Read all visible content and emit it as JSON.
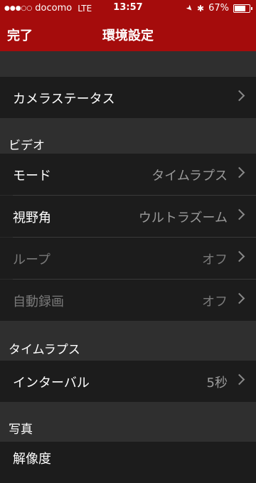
{
  "status_bar": {
    "signal_dots": "●●●○○",
    "carrier": "docomo",
    "network": "LTE",
    "time": "13:57",
    "location_icon": "location-arrow-icon",
    "bluetooth_icon": "bluetooth-icon",
    "bluetooth_glyph": "✱",
    "battery_percent": "67%",
    "battery_level": 0.67
  },
  "nav": {
    "done_label": "完了",
    "title": "環境設定"
  },
  "camera_status": {
    "label": "カメラステータス"
  },
  "video": {
    "header": "ビデオ",
    "rows": [
      {
        "label": "モード",
        "value": "タイムラプス",
        "enabled": true
      },
      {
        "label": "視野角",
        "value": "ウルトラズーム",
        "enabled": true
      },
      {
        "label": "ループ",
        "value": "オフ",
        "enabled": false
      },
      {
        "label": "自動録画",
        "value": "オフ",
        "enabled": false
      }
    ]
  },
  "timelapse": {
    "header": "タイムラプス",
    "rows": [
      {
        "label": "インターバル",
        "value": "5秒",
        "enabled": true
      }
    ]
  },
  "photo": {
    "header": "写真",
    "partial_row_label": "解像度"
  },
  "colors": {
    "accent": "#a50c0c",
    "row_bg": "#1c1c1c",
    "section_bg": "#2f2f2f"
  }
}
